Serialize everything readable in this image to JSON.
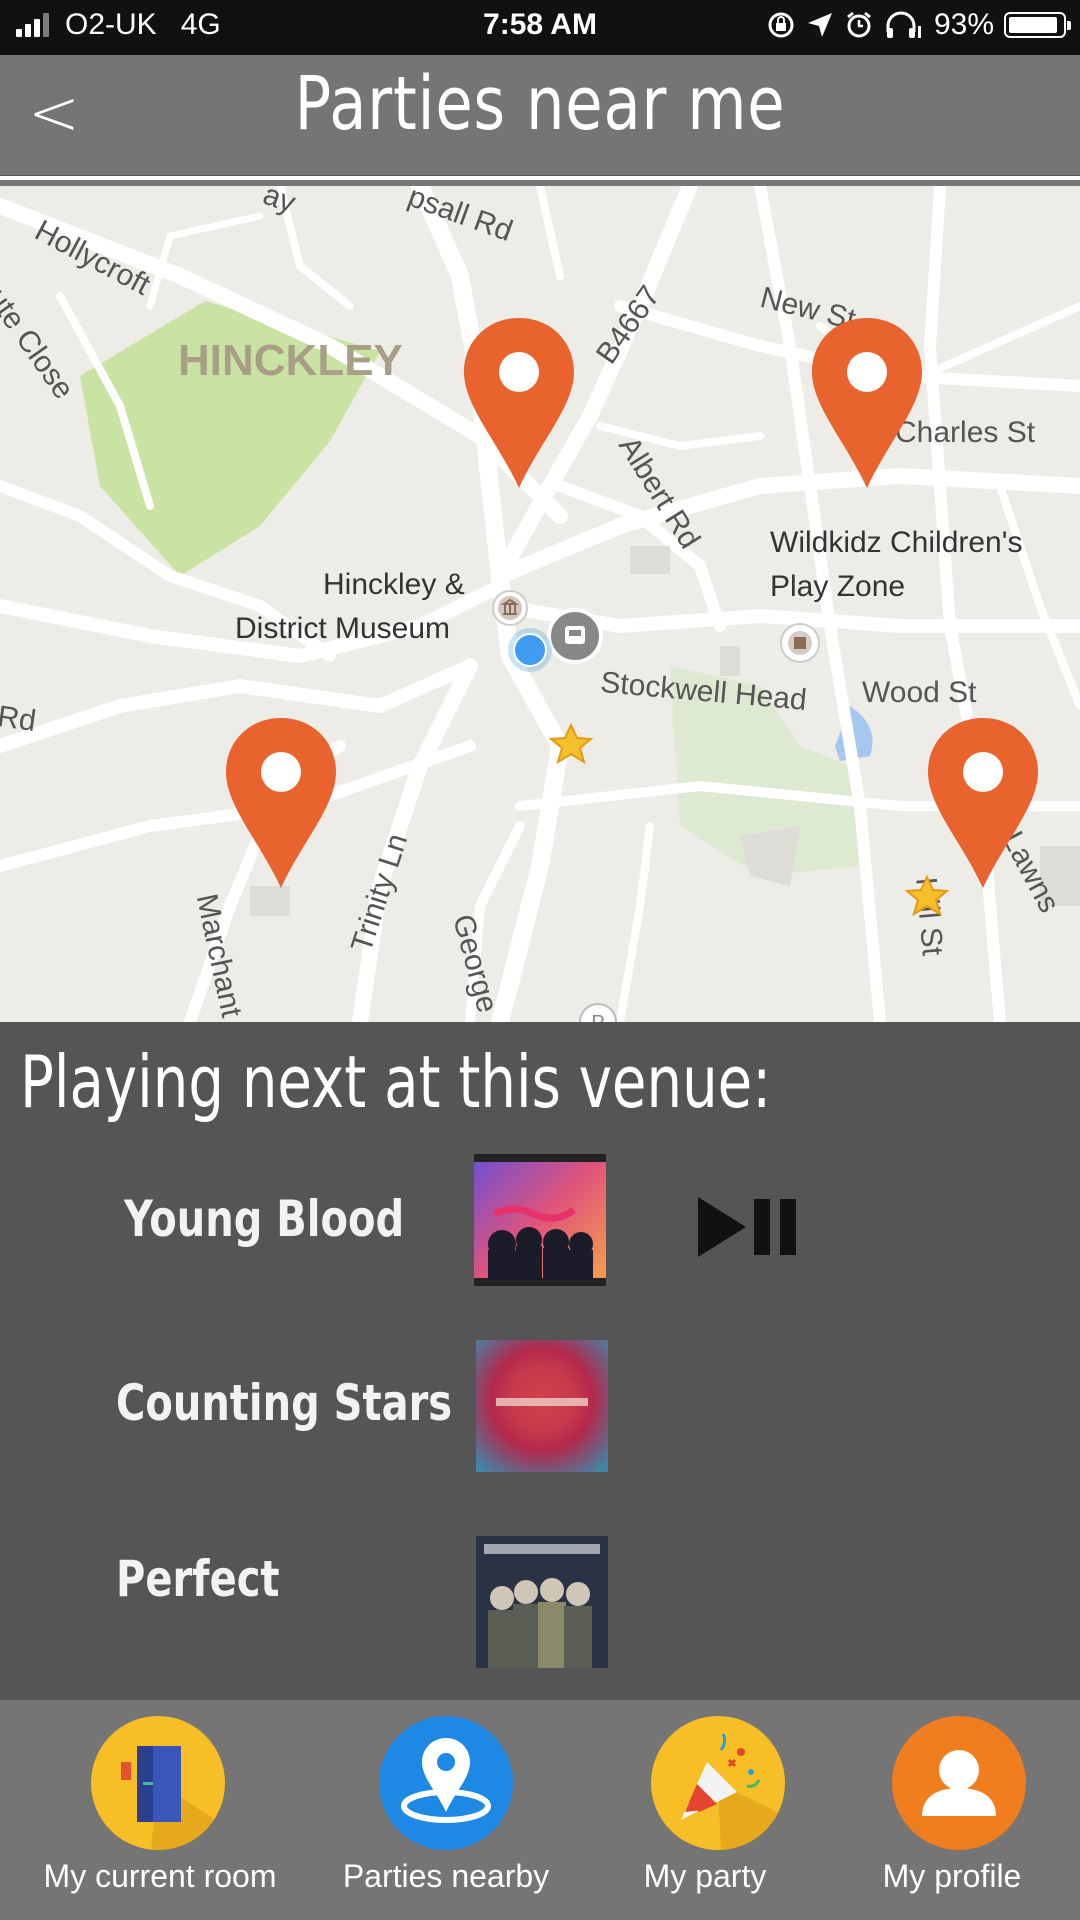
{
  "status_bar": {
    "carrier": "O2-UK",
    "network": "4G",
    "time": "7:58 AM",
    "battery_percent": "93%",
    "battery_level": 0.93,
    "icons": [
      "signal-icon",
      "screen-rotation-lock-icon",
      "location-arrow-icon",
      "alarm-icon",
      "headphones-icon",
      "battery-icon"
    ]
  },
  "header": {
    "back_label": "<",
    "title": "Parties near me"
  },
  "map": {
    "labels": {
      "hollycroft": "Hollycroft",
      "bute_close": "Bute Close",
      "hinckley": "HINCKLEY",
      "upsall_rd": "psall Rd",
      "ay": "ay",
      "b4667": "B4667",
      "new_st": "New St",
      "charles_st": "Charles St",
      "albert_rd": "Albert Rd",
      "wildkidz_1": "Wildkidz Children's",
      "wildkidz_2": "Play Zone",
      "museum_1": "Hinckley &",
      "museum_2": "District Museum",
      "stockwell_head": "Stockwell Head",
      "wood_st": "Wood St",
      "rd": "Rd",
      "trinity_ln": "Trinity Ln",
      "marchant": "Marchant",
      "george": "George",
      "hill_st": "Hill St",
      "lawns": "Lawns"
    },
    "pins": [
      "party-pin-1",
      "party-pin-2",
      "party-pin-3",
      "party-pin-4"
    ],
    "pin_color": "#E8632E"
  },
  "playlist": {
    "heading": "Playing next at this venue:",
    "tracks": [
      {
        "title": "Young Blood"
      },
      {
        "title": "Counting Stars"
      },
      {
        "title": "Perfect"
      }
    ],
    "controls_icon": "play-pause-icon"
  },
  "nav": {
    "items": [
      {
        "label": "My current room",
        "icon": "door-icon",
        "color": "#F7BE25"
      },
      {
        "label": "Parties nearby",
        "icon": "map-pin-icon",
        "color": "#1E88E5"
      },
      {
        "label": "My party",
        "icon": "party-popper-icon",
        "color": "#F7BE25"
      },
      {
        "label": "My profile",
        "icon": "user-icon",
        "color": "#F07D1E"
      }
    ]
  }
}
